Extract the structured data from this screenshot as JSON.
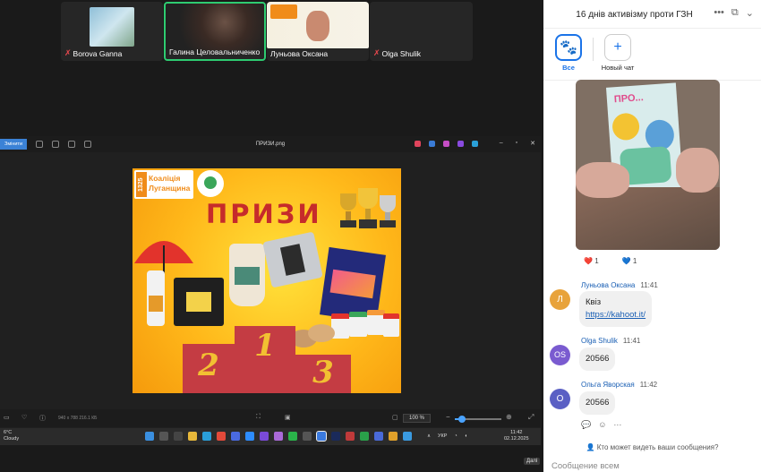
{
  "gallery": {
    "participants": [
      {
        "name": "Borova Ganna",
        "muted": true
      },
      {
        "name": "Галина Целовальниченко",
        "muted": false,
        "active_speaker": true
      },
      {
        "name": "Луньова Оксана",
        "muted": false
      },
      {
        "name": "Olga Shulik",
        "muted": true
      }
    ]
  },
  "viewer": {
    "edit_label": "Змінити",
    "filename": "ПРИЗИ.png",
    "dims": "940 x 788   216.1 КБ",
    "zoom": "100 %",
    "side_label": "Далі"
  },
  "poster": {
    "logo_number": "1325",
    "logo_text": [
      "Коаліція",
      "Луганщина"
    ],
    "title": "ПРИЗИ",
    "places": [
      "2",
      "1",
      "3"
    ],
    "colors": {
      "title": "#c62b2b",
      "podium": "#c43c43",
      "place": "#f2c032"
    }
  },
  "taskbar": {
    "weather_temp": "6°C",
    "weather_desc": "Cloudy",
    "lang": "УКР",
    "time": "11:42",
    "date": "02.12.2025"
  },
  "chat": {
    "title": "16 днів активізму проти ГЗН",
    "tabs": [
      {
        "label": "Все",
        "icon": "paw-icon",
        "selected": true
      },
      {
        "label": "Новый чат",
        "icon": "plus-icon",
        "selected": false
      }
    ],
    "reactions": [
      {
        "emoji": "❤️",
        "count": "1"
      },
      {
        "emoji": "💙",
        "count": "1"
      }
    ],
    "messages": [
      {
        "author": "Луньова Оксана",
        "time": "11:41",
        "initials": "Л",
        "color": "#e8a33b",
        "lines": [
          "Квіз"
        ],
        "link": "https://kahoot.it/"
      },
      {
        "author": "Olga Shulik",
        "time": "11:41",
        "initials": "OS",
        "color": "#7a5bd0",
        "lines": [
          "20566"
        ]
      },
      {
        "author": "Ольга Яворская",
        "time": "11:42",
        "initials": "О",
        "color": "#5a5fc4",
        "lines": [
          "20566"
        ]
      }
    ],
    "privacy_note": "Кто может видеть ваши сообщения?",
    "compose_placeholder": "Сообщение всем"
  }
}
